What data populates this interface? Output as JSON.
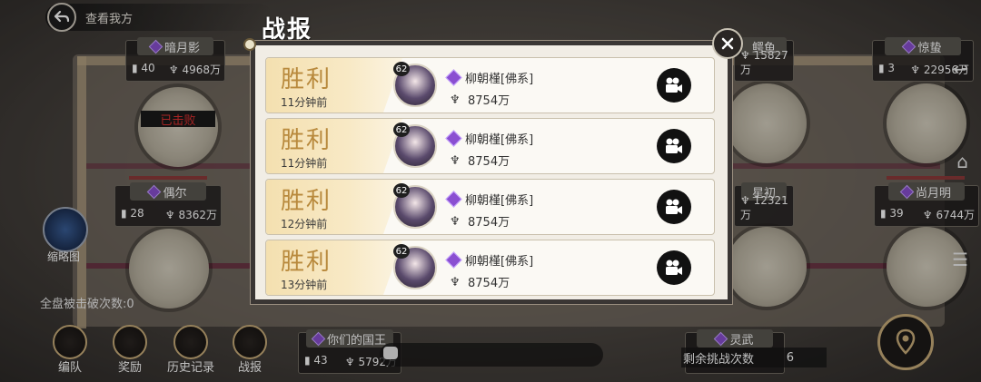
{
  "header": {
    "back_label": "查看我方"
  },
  "map_nodes": [
    {
      "name": "暗月影",
      "count": "40",
      "power": "4968万",
      "defeated": "已击败"
    },
    {
      "name": "偶尔",
      "count": "28",
      "power": "8362万"
    },
    {
      "name": "鳄鱼",
      "count": "",
      "power": "15827万"
    },
    {
      "name": "惊蛰",
      "count": "3",
      "power": "22956万"
    },
    {
      "name": "星初",
      "count": "",
      "power": "12321万"
    },
    {
      "name": "尚月明",
      "count": "39",
      "power": "6744万"
    },
    {
      "name": "你们的国王",
      "count": "43",
      "power": "5792万"
    },
    {
      "name": "灵武",
      "count": "",
      "power": ""
    }
  ],
  "left_panel": {
    "mini_map_label": "缩略图",
    "total_broken": "全盘被击破次数:0"
  },
  "bottom_bar": {
    "formation": "编队",
    "reward": "奖励",
    "history": "历史记录",
    "battle_report": "战报"
  },
  "remaining": {
    "label": "剩余挑战次数",
    "value": "6"
  },
  "dialog": {
    "title": "战报",
    "reports": [
      {
        "result": "胜利",
        "time": "11分钟前",
        "level": "62",
        "player": "柳朝槿[佛系]",
        "power": "8754万"
      },
      {
        "result": "胜利",
        "time": "11分钟前",
        "level": "62",
        "player": "柳朝槿[佛系]",
        "power": "8754万"
      },
      {
        "result": "胜利",
        "time": "12分钟前",
        "level": "62",
        "player": "柳朝槿[佛系]",
        "power": "8754万"
      },
      {
        "result": "胜利",
        "time": "13分钟前",
        "level": "62",
        "player": "柳朝槿[佛系]",
        "power": "8754万"
      }
    ]
  },
  "colors": {
    "win_gold": "#b8893c",
    "defeated_red": "#e03030",
    "gem_purple": "#8a4fd1"
  },
  "icons": [
    "back-arrow-icon",
    "close-icon",
    "camera-icon",
    "location-icon",
    "home-icon",
    "menu-icon",
    "chat-icon"
  ]
}
